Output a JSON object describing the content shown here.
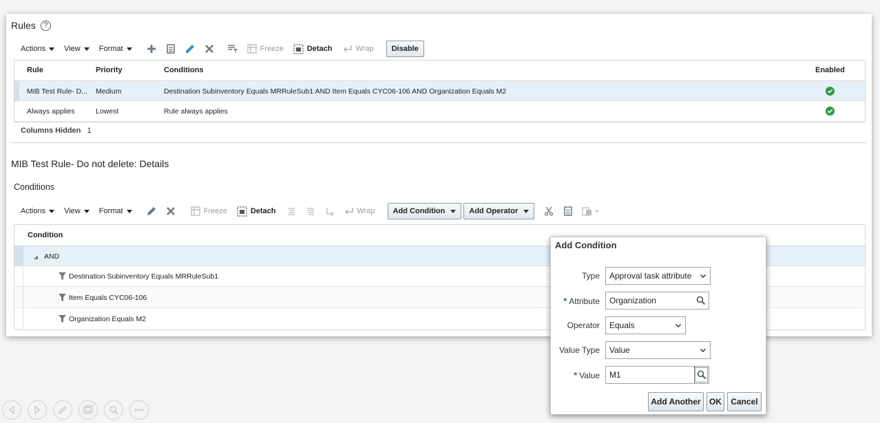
{
  "rules_section": {
    "title": "Rules",
    "toolbar": {
      "actions": "Actions",
      "view": "View",
      "format": "Format",
      "freeze": "Freeze",
      "detach": "Detach",
      "wrap": "Wrap",
      "disable": "Disable"
    },
    "columns": [
      "Rule",
      "Priority",
      "Conditions",
      "Enabled"
    ],
    "rows": [
      {
        "rule": "MIB Test Rule- D...",
        "priority": "Medium",
        "conditions": "Destination Subinventory Equals MRRuleSub1 AND Item Equals CYC06-106 AND Organization Equals M2"
      },
      {
        "rule": "Always applies",
        "priority": "Lowest",
        "conditions": "Rule always applies"
      }
    ],
    "columns_hidden_label": "Columns Hidden",
    "columns_hidden_count": "1"
  },
  "details_section": {
    "title": "MIB Test Rule- Do not delete: Details",
    "conditions_title": "Conditions",
    "toolbar": {
      "actions": "Actions",
      "view": "View",
      "format": "Format",
      "freeze": "Freeze",
      "detach": "Detach",
      "wrap": "Wrap",
      "add_condition": "Add Condition",
      "add_operator": "Add Operator"
    },
    "column": "Condition",
    "tree": {
      "root": "AND",
      "children": [
        "Destination Subinventory Equals MRRuleSub1",
        "Item Equals CYC06-106",
        "Organization Equals M2"
      ]
    }
  },
  "dialog": {
    "title": "Add Condition",
    "type_label": "Type",
    "type_value": "Approval task attribute",
    "attribute_label": "Attribute",
    "attribute_value": "Organization",
    "operator_label": "Operator",
    "operator_value": "Equals",
    "value_type_label": "Value Type",
    "value_type_value": "Value",
    "value_label": "Value",
    "value_value": "M1",
    "required_mark": "*",
    "add_another": "Add Another",
    "ok": "OK",
    "cancel": "Cancel"
  },
  "colors": {
    "selected_row": "#e6f0f9",
    "enabled_check": "#2e9a45",
    "required_asterisk": "#2b6ea9"
  }
}
